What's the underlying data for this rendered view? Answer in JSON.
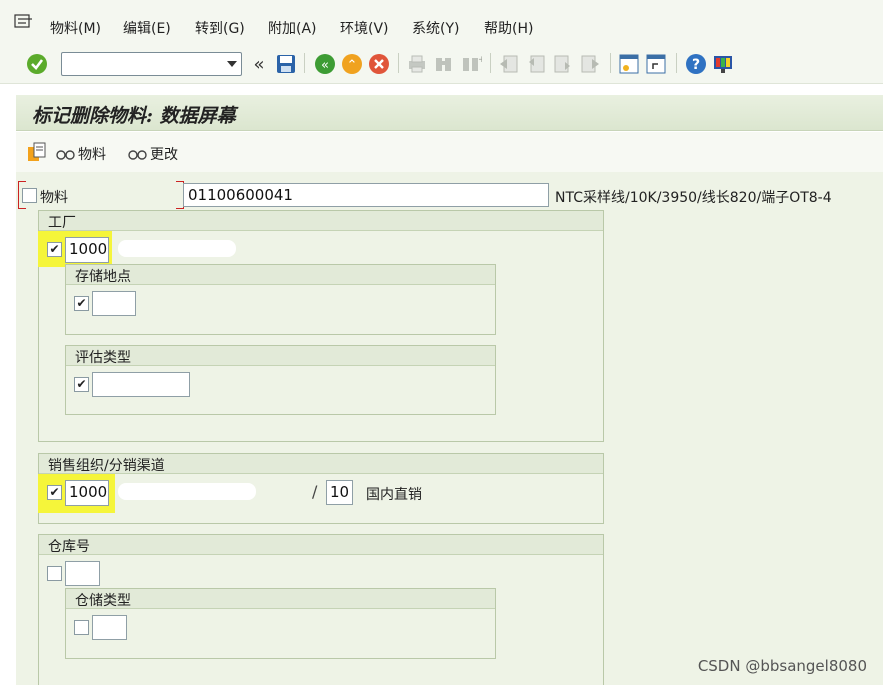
{
  "menu": {
    "items": [
      "物料(M)",
      "编辑(E)",
      "转到(G)",
      "附加(A)",
      "环境(V)",
      "系统(Y)",
      "帮助(H)"
    ]
  },
  "toolbar": {
    "command_value": "",
    "icons": [
      "enter-check-icon",
      "history-back-icon",
      "save-icon",
      "back-icon",
      "exit-icon",
      "cancel-icon",
      "print-icon",
      "find-icon",
      "find-next-icon",
      "first-page-icon",
      "prev-page-icon",
      "next-page-icon",
      "last-page-icon",
      "new-session-icon",
      "shortcut-icon",
      "help-icon",
      "layout-icon"
    ]
  },
  "title": "标记删除物料: 数据屏幕",
  "app_toolbar": {
    "material_btn": "物料",
    "change_btn": "更改"
  },
  "material": {
    "label": "物料",
    "value": "01100600041",
    "description": "NTC采样线/10K/3950/线长820/端子OT8-4",
    "checked": false
  },
  "plant_group": {
    "title": "工厂",
    "plant_value": "1000",
    "checked": true,
    "storage": {
      "title": "存储地点",
      "checked": true,
      "value": ""
    },
    "valuation": {
      "title": "评估类型",
      "checked": true,
      "value": ""
    }
  },
  "sales_group": {
    "title": "销售组织/分销渠道",
    "org_value": "1000",
    "checked": true,
    "channel_value": "10",
    "channel_desc": "国内直销"
  },
  "warehouse_group": {
    "title": "仓库号",
    "checked": false,
    "value": "",
    "storage_type": {
      "title": "仓储类型",
      "checked": false,
      "value": ""
    }
  },
  "watermark": "CSDN @bbsangel8080"
}
